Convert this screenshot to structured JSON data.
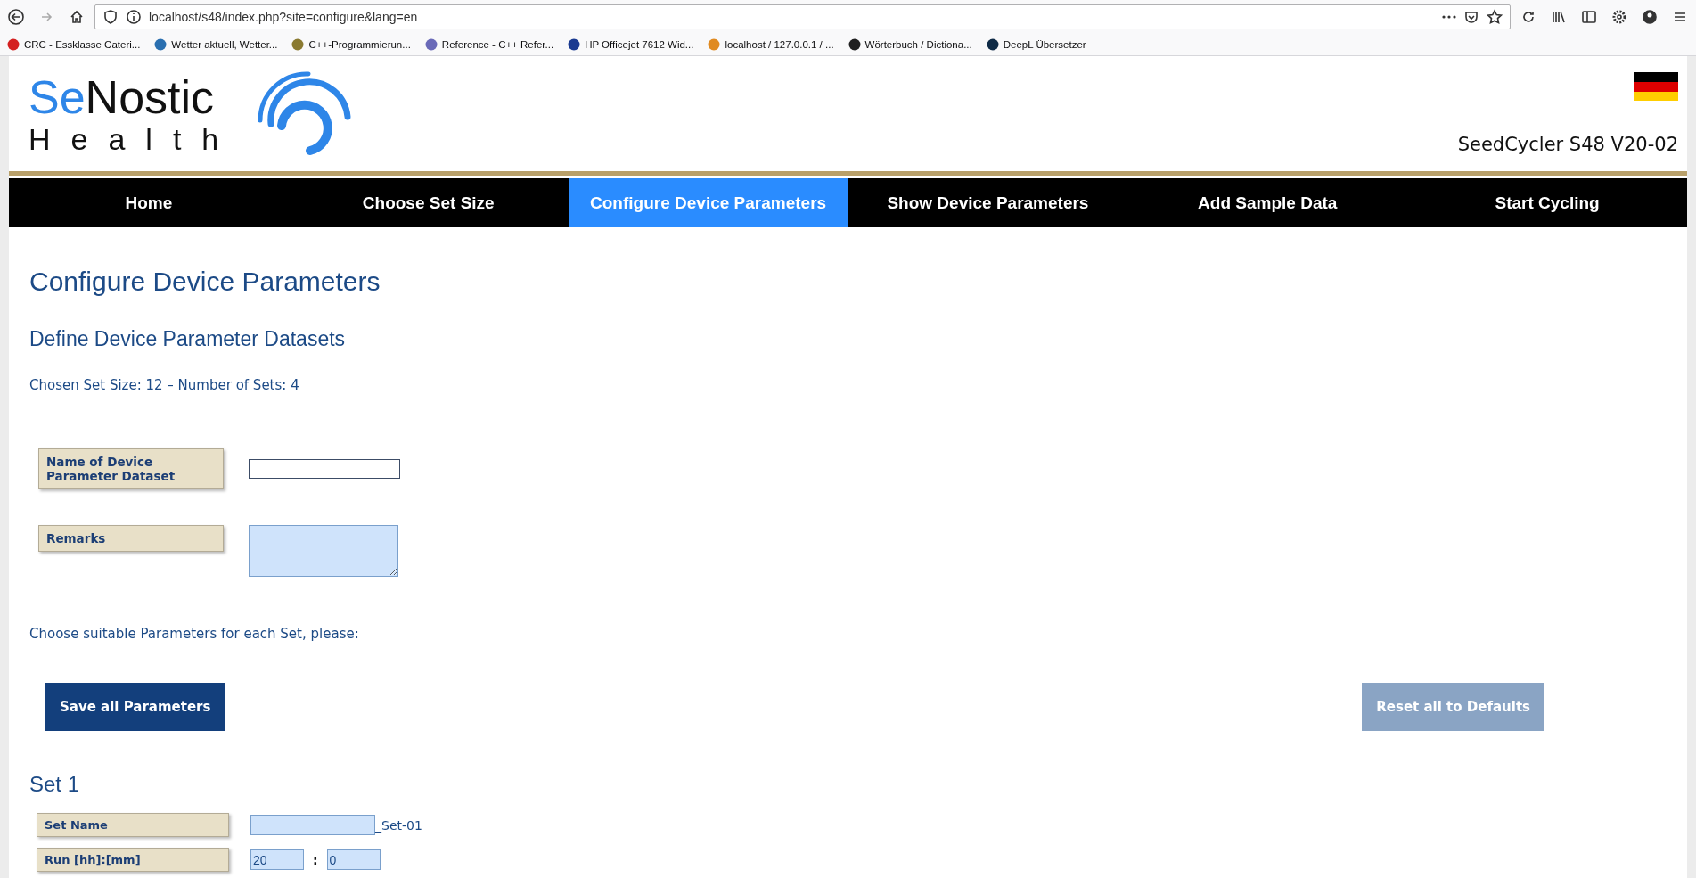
{
  "browser": {
    "url": "localhost/s48/index.php?site=configure&lang=en",
    "bookmarks": [
      {
        "label": "CRC - Essklasse Cateri...",
        "color": "#d42020"
      },
      {
        "label": "Wetter aktuell, Wetter...",
        "color": "#2a6fb0"
      },
      {
        "label": "C++-Programmierun...",
        "color": "#8a7a30"
      },
      {
        "label": "Reference - C++ Refer...",
        "color": "#6a6ab8"
      },
      {
        "label": "HP Officejet 7612 Wid...",
        "color": "#1a3a90"
      },
      {
        "label": "localhost / 127.0.0.1 / ...",
        "color": "#e08a20"
      },
      {
        "label": "Wörterbuch / Dictiona...",
        "color": "#202020"
      },
      {
        "label": "DeepL Übersetzer",
        "color": "#0f2b46"
      }
    ]
  },
  "header": {
    "logo_first": "Se",
    "logo_second": "Nostic",
    "logo_tagline": "Health",
    "device": "SeedCycler S48 V20-02"
  },
  "nav": [
    {
      "label": "Home",
      "selected": false
    },
    {
      "label": "Choose Set Size",
      "selected": false
    },
    {
      "label": "Configure Device Parameters",
      "selected": true
    },
    {
      "label": "Show Device Parameters",
      "selected": false
    },
    {
      "label": "Add Sample Data",
      "selected": false
    },
    {
      "label": "Start Cycling",
      "selected": false
    }
  ],
  "page": {
    "title": "Configure Device Parameters",
    "subtitle": "Define Device Parameter Datasets",
    "set_info": "Chosen Set Size: 12 – Number of Sets: 4",
    "fields": [
      {
        "label": "Name of Device Parameter Dataset",
        "kind": "input"
      },
      {
        "label": "Remarks",
        "kind": "textarea"
      }
    ],
    "instructions": "Choose suitable Parameters for each Set, please:",
    "buttons": [
      {
        "label": "Save all Parameters",
        "kind": "primary"
      },
      {
        "label": "Reset all to Defaults",
        "kind": "secondary"
      }
    ],
    "sets": [
      {
        "title": "Set 1",
        "rows": [
          {
            "label": "Set Name",
            "kind": "text",
            "suffix": "_Set-01"
          },
          {
            "label": "Run [hh]:[mm]",
            "kind": "time",
            "hours": "20",
            "separator": ":",
            "minutes": "0"
          }
        ]
      }
    ]
  }
}
